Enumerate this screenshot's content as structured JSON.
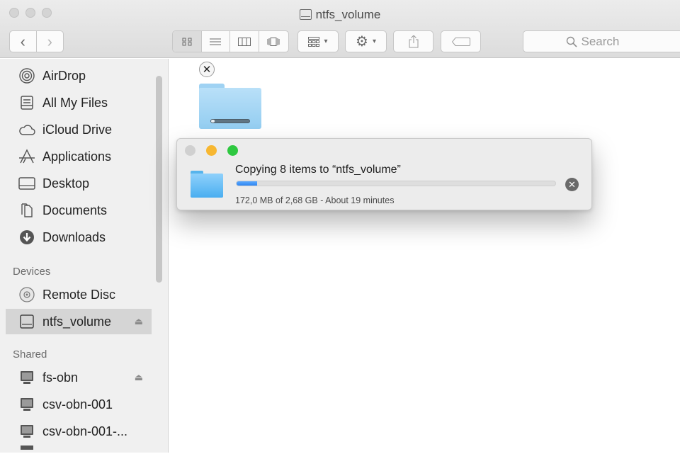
{
  "window": {
    "title": "ntfs_volume",
    "title_icon": "disk-icon"
  },
  "toolbar": {
    "back_glyph": "‹",
    "forward_glyph": "›",
    "view_modes": [
      "icon-view",
      "list-view",
      "column-view",
      "cover-flow"
    ],
    "active_view": "icon-view",
    "arrange_icon": "arrange-grid-icon",
    "action_icon": "gear-icon",
    "share_icon": "share-icon",
    "tag_icon": "tag-icon"
  },
  "search": {
    "placeholder": "Search"
  },
  "sidebar": {
    "favorites": [
      {
        "label": "AirDrop",
        "icon": "airdrop-icon"
      },
      {
        "label": "All My Files",
        "icon": "all-files-icon"
      },
      {
        "label": "iCloud Drive",
        "icon": "cloud-icon"
      },
      {
        "label": "Applications",
        "icon": "applications-icon"
      },
      {
        "label": "Desktop",
        "icon": "desktop-icon"
      },
      {
        "label": "Documents",
        "icon": "documents-icon"
      },
      {
        "label": "Downloads",
        "icon": "downloads-icon"
      }
    ],
    "devices_header": "Devices",
    "devices": [
      {
        "label": "Remote Disc",
        "icon": "remote-disc-icon"
      },
      {
        "label": "ntfs_volume",
        "icon": "disk-icon",
        "selected": true,
        "eject": "⏏"
      }
    ],
    "shared_header": "Shared",
    "shared": [
      {
        "label": "fs-obn",
        "icon": "server-icon",
        "eject": "⏏"
      },
      {
        "label": "csv-obn-001",
        "icon": "server-icon"
      },
      {
        "label": "csv-obn-001-...",
        "icon": "server-icon"
      }
    ]
  },
  "content": {
    "copy_folder_progress": 0.06,
    "cancel_glyph": "✕"
  },
  "copy_dialog": {
    "title": "Copying 8 items to “ntfs_volume”",
    "status": "172,0 MB of 2,68 GB - About 19 minutes",
    "progress": 0.064,
    "cancel_glyph": "✕",
    "colors": {
      "close": "#d0d0d0",
      "minimize": "#f7b731",
      "zoom": "#2ec840",
      "progress": "#3b8ff3"
    }
  }
}
